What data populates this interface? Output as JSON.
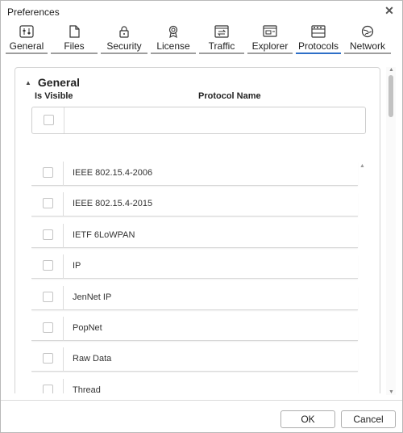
{
  "window": {
    "title": "Preferences",
    "close_glyph": "✕"
  },
  "tabs": [
    {
      "label": "General",
      "icon": "sliders-icon",
      "active": false
    },
    {
      "label": "Files",
      "icon": "file-icon",
      "active": false
    },
    {
      "label": "Security",
      "icon": "lock-icon",
      "active": false
    },
    {
      "label": "License",
      "icon": "badge-icon",
      "active": false
    },
    {
      "label": "Traffic",
      "icon": "traffic-icon",
      "active": false
    },
    {
      "label": "Explorer",
      "icon": "explorer-icon",
      "active": false
    },
    {
      "label": "Protocols",
      "icon": "protocols-icon",
      "active": true
    },
    {
      "label": "Network",
      "icon": "globe-icon",
      "active": false
    }
  ],
  "section": {
    "title": "General",
    "collapse_glyph": "▲",
    "columns": {
      "visible": "Is Visible",
      "name": "Protocol Name"
    },
    "filter": {
      "name": ""
    }
  },
  "protocols": [
    {
      "name": "IEEE 802.15.4-2006",
      "visible": false
    },
    {
      "name": "IEEE 802.15.4-2015",
      "visible": false
    },
    {
      "name": "IETF 6LoWPAN",
      "visible": false
    },
    {
      "name": "IP",
      "visible": false
    },
    {
      "name": "JenNet IP",
      "visible": false
    },
    {
      "name": "PopNet",
      "visible": false
    },
    {
      "name": "Raw Data",
      "visible": false
    },
    {
      "name": "Thread",
      "visible": false
    }
  ],
  "footer": {
    "ok": "OK",
    "cancel": "Cancel"
  },
  "colors": {
    "accent": "#2e6fc7",
    "tab_line": "#9e9e9e"
  }
}
